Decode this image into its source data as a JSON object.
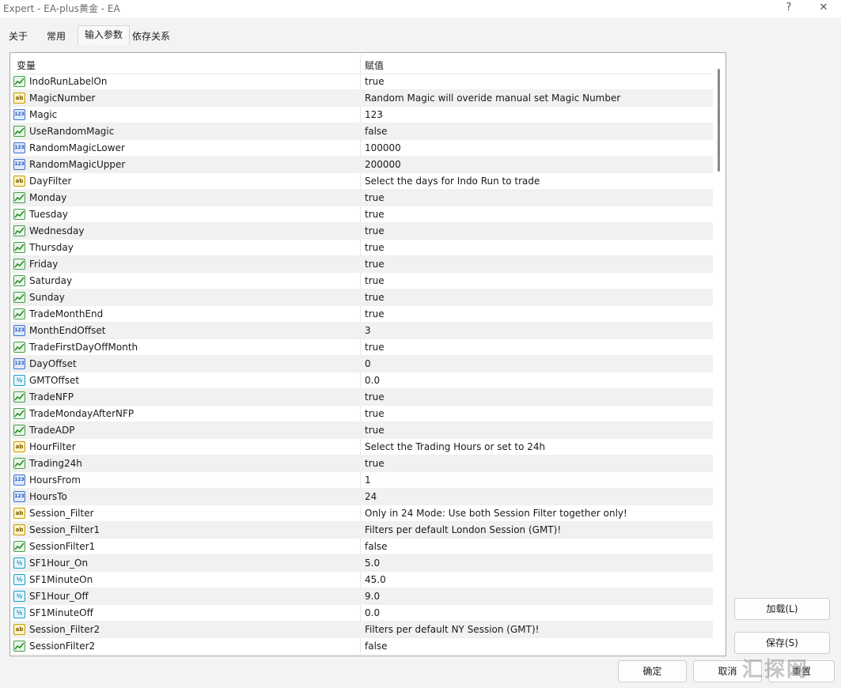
{
  "window": {
    "title": "Expert - EA-plus黄金 - EA",
    "help": "?",
    "close": "✕"
  },
  "tabs": [
    {
      "label": "关于"
    },
    {
      "label": "常用"
    },
    {
      "label": "输入参数",
      "active": true
    },
    {
      "label": "依存关系"
    }
  ],
  "grid": {
    "col_variable": "变量",
    "col_value": "赋值",
    "rows": [
      {
        "type": "bool",
        "name": "IndoRunLabelOn",
        "value": "true"
      },
      {
        "type": "str",
        "name": "MagicNumber",
        "value": "Random Magic will overide manual set Magic Number"
      },
      {
        "type": "int",
        "name": "Magic",
        "value": "123"
      },
      {
        "type": "bool",
        "name": "UseRandomMagic",
        "value": "false"
      },
      {
        "type": "int",
        "name": "RandomMagicLower",
        "value": "100000"
      },
      {
        "type": "int",
        "name": "RandomMagicUpper",
        "value": "200000"
      },
      {
        "type": "str",
        "name": "DayFilter",
        "value": "Select the days for Indo Run to trade"
      },
      {
        "type": "bool",
        "name": "Monday",
        "value": "true"
      },
      {
        "type": "bool",
        "name": "Tuesday",
        "value": "true"
      },
      {
        "type": "bool",
        "name": "Wednesday",
        "value": "true"
      },
      {
        "type": "bool",
        "name": "Thursday",
        "value": "true"
      },
      {
        "type": "bool",
        "name": "Friday",
        "value": "true"
      },
      {
        "type": "bool",
        "name": "Saturday",
        "value": "true"
      },
      {
        "type": "bool",
        "name": "Sunday",
        "value": "true"
      },
      {
        "type": "bool",
        "name": "TradeMonthEnd",
        "value": "true"
      },
      {
        "type": "int",
        "name": "MonthEndOffset",
        "value": "3"
      },
      {
        "type": "bool",
        "name": "TradeFirstDayOffMonth",
        "value": "true"
      },
      {
        "type": "int",
        "name": "DayOffset",
        "value": "0"
      },
      {
        "type": "dbl",
        "name": "GMTOffset",
        "value": "0.0"
      },
      {
        "type": "bool",
        "name": "TradeNFP",
        "value": "true"
      },
      {
        "type": "bool",
        "name": "TradeMondayAfterNFP",
        "value": "true"
      },
      {
        "type": "bool",
        "name": "TradeADP",
        "value": "true"
      },
      {
        "type": "str",
        "name": "HourFilter",
        "value": "Select the Trading Hours or set to 24h"
      },
      {
        "type": "bool",
        "name": "Trading24h",
        "value": "true"
      },
      {
        "type": "int",
        "name": "HoursFrom",
        "value": "1"
      },
      {
        "type": "int",
        "name": "HoursTo",
        "value": "24"
      },
      {
        "type": "str",
        "name": "Session_Filter",
        "value": "Only in 24 Mode: Use both Session Filter together only!"
      },
      {
        "type": "str",
        "name": "Session_Filter1",
        "value": "Filters per default London Session (GMT)!"
      },
      {
        "type": "bool",
        "name": "SessionFilter1",
        "value": "false"
      },
      {
        "type": "dbl",
        "name": "SF1Hour_On",
        "value": "5.0"
      },
      {
        "type": "dbl",
        "name": "SF1MinuteOn",
        "value": "45.0"
      },
      {
        "type": "dbl",
        "name": "SF1Hour_Off",
        "value": "9.0"
      },
      {
        "type": "dbl",
        "name": "SF1MinuteOff",
        "value": "0.0"
      },
      {
        "type": "str",
        "name": "Session_Filter2",
        "value": "Filters per default NY Session (GMT)!"
      },
      {
        "type": "bool",
        "name": "SessionFilter2",
        "value": "false"
      }
    ]
  },
  "icons": {
    "str": "ab",
    "int": "123",
    "dbl": "½"
  },
  "buttons": {
    "load": "加载(L)",
    "save": "保存(S)",
    "ok": "确定",
    "cancel": "取消",
    "reset": "重置"
  },
  "watermark": "汇探网"
}
